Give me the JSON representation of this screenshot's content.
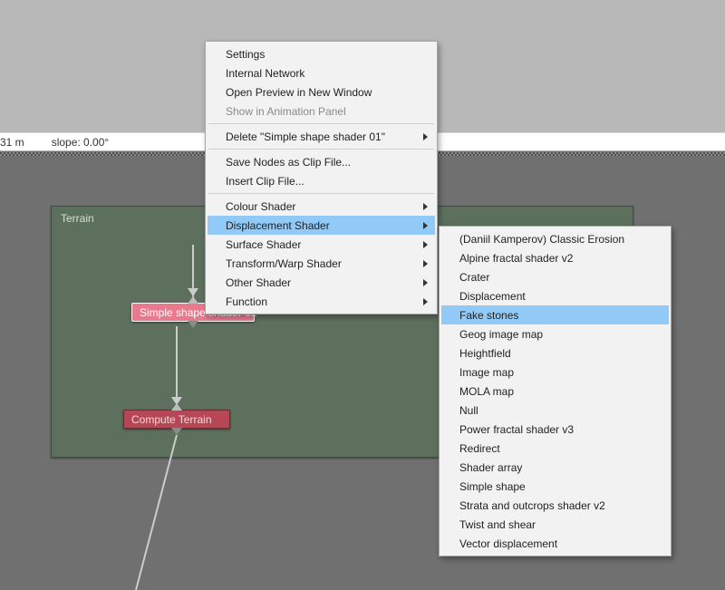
{
  "status": {
    "item1": "31 m",
    "item2": "slope: 0.00°"
  },
  "terrain": {
    "title": "Terrain",
    "node1": "Simple shape shader 01",
    "node2": "Compute Terrain"
  },
  "menu1": {
    "settings": "Settings",
    "internal_network": "Internal Network",
    "open_preview": "Open Preview in New Window",
    "show_anim": "Show in Animation Panel",
    "delete": "Delete \"Simple shape shader 01\"",
    "save_clip": "Save Nodes as Clip File...",
    "insert_clip": "Insert Clip File...",
    "colour_shader": "Colour Shader",
    "displacement_shader": "Displacement Shader",
    "surface_shader": "Surface Shader",
    "transform_warp": "Transform/Warp Shader",
    "other_shader": "Other Shader",
    "function": "Function"
  },
  "menu2": {
    "classic_erosion": "(Daniil Kamperov) Classic Erosion",
    "alpine": "Alpine fractal shader v2",
    "crater": "Crater",
    "displacement": "Displacement",
    "fake_stones": "Fake stones",
    "geog": "Geog image map",
    "heightfield": "Heightfield",
    "image_map": "Image map",
    "mola": "MOLA map",
    "null": "Null",
    "power_fractal": "Power fractal shader v3",
    "redirect": "Redirect",
    "shader_array": "Shader array",
    "simple_shape": "Simple shape",
    "strata": "Strata and outcrops shader v2",
    "twist": "Twist and shear",
    "vector_disp": "Vector displacement"
  }
}
